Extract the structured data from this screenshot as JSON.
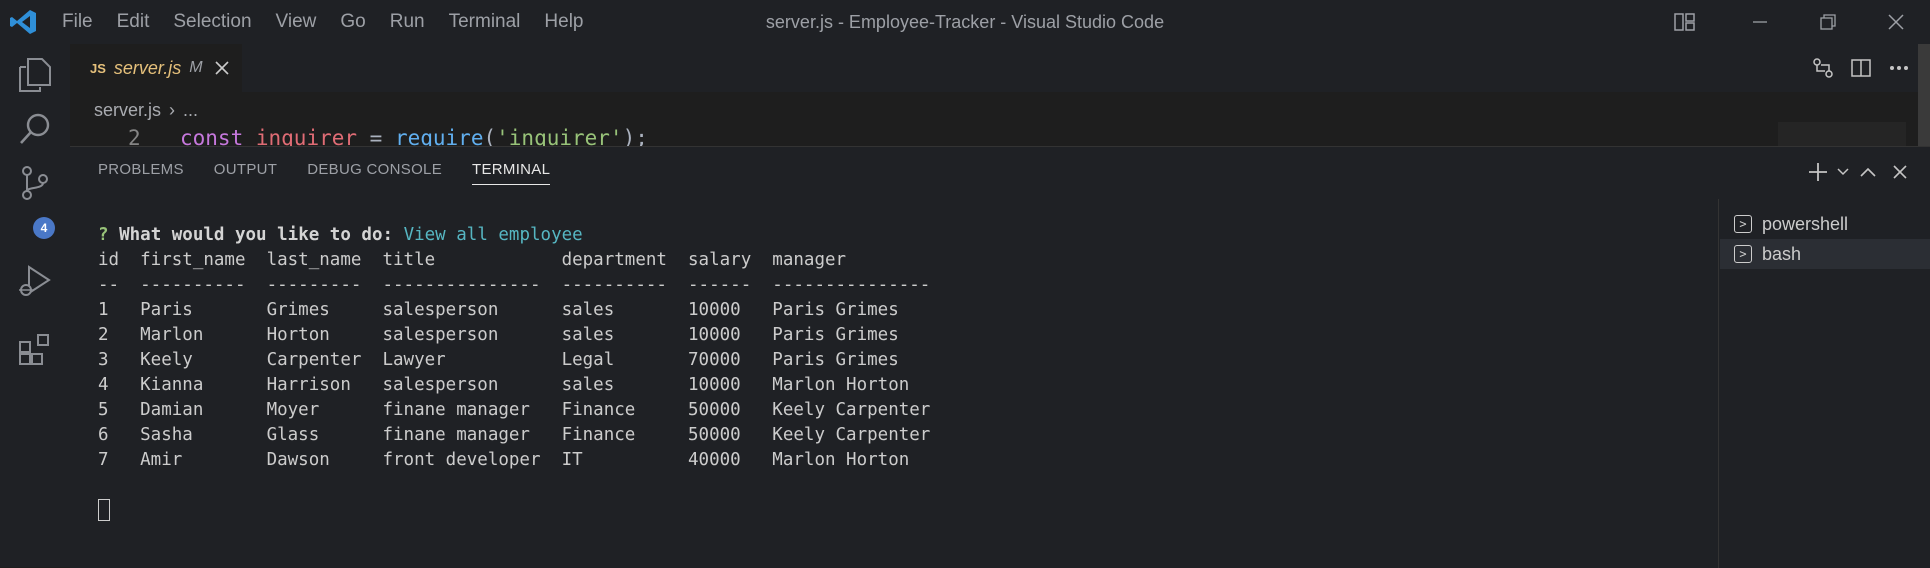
{
  "menu": [
    "File",
    "Edit",
    "Selection",
    "View",
    "Go",
    "Run",
    "Terminal",
    "Help"
  ],
  "window_title": "server.js - Employee-Tracker - Visual Studio Code",
  "activity": {
    "source_control_badge": "4"
  },
  "tab": {
    "lang": "JS",
    "filename": "server.js",
    "status": "M"
  },
  "breadcrumb": {
    "file": "server.js",
    "rest": "..."
  },
  "editor": {
    "line_number": "2",
    "tokens": {
      "kw": "const",
      "var": "inquirer",
      "op": " = ",
      "fn": "require",
      "p1": "(",
      "str": "'inquirer'",
      "p2": ");"
    }
  },
  "panel": {
    "tabs": [
      "PROBLEMS",
      "OUTPUT",
      "DEBUG CONSOLE",
      "TERMINAL"
    ],
    "active_tab": "TERMINAL"
  },
  "terminal": {
    "q": "?",
    "prompt": " What would you like to do:",
    "answer": " View all employee",
    "lines": [
      "id  first_name  last_name  title            department  salary  manager",
      "--  ----------  ---------  ---------------  ----------  ------  ---------------",
      "1   Paris       Grimes     salesperson      sales       10000   Paris Grimes",
      "2   Marlon      Horton     salesperson      sales       10000   Paris Grimes",
      "3   Keely       Carpenter  Lawyer           Legal       70000   Paris Grimes",
      "4   Kianna      Harrison   salesperson      sales       10000   Marlon Horton",
      "5   Damian      Moyer      finane manager   Finance     50000   Keely Carpenter",
      "6   Sasha       Glass      finane manager   Finance     50000   Keely Carpenter",
      "7   Amir        Dawson     front developer  IT          40000   Marlon Horton"
    ]
  },
  "terminal_instances": [
    {
      "name": "powershell",
      "selected": false
    },
    {
      "name": "bash",
      "selected": true
    }
  ]
}
